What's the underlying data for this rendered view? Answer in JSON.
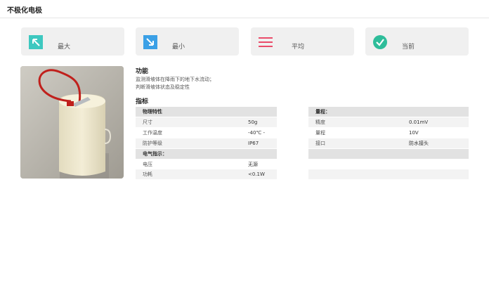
{
  "header": {
    "title": "不极化电极"
  },
  "stats": [
    {
      "label": "最大",
      "icon": "arrow-up-left-icon",
      "color": "#3ec8c0"
    },
    {
      "label": "最小",
      "icon": "arrow-down-right-icon",
      "color": "#3ba0e6"
    },
    {
      "label": "平均",
      "icon": "lines-icon",
      "color": "#ea4c6a"
    },
    {
      "label": "当前",
      "icon": "check-circle-icon",
      "color": "#2ebd9a"
    }
  ],
  "function": {
    "title": "功能",
    "lines": [
      "监测滑坡体在降雨下的地下水流动；",
      "判断滑坡体状态及稳定性"
    ]
  },
  "specs": {
    "title": "指标",
    "left": {
      "group1": "物理特性",
      "rows1": [
        {
          "key": "尺寸",
          "value": "50g"
        },
        {
          "key": "工作温度",
          "value": "-40℃ - +80℃"
        },
        {
          "key": "防护等级",
          "value": "IP67"
        }
      ],
      "group2": "电气指示：",
      "rows2": [
        {
          "key": "电压",
          "value": "无源"
        },
        {
          "key": "功耗",
          "value": "<0.1W"
        }
      ]
    },
    "right": {
      "group1": "量程：",
      "rows1": [
        {
          "key": "精度",
          "value": "0.01mV"
        },
        {
          "key": "量程",
          "value": "10V"
        },
        {
          "key": "接口",
          "value": "防水接头"
        }
      ]
    }
  }
}
